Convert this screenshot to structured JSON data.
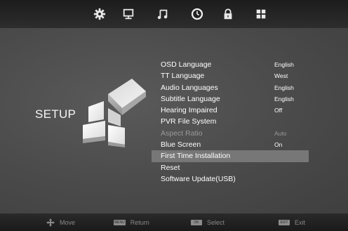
{
  "topbar": {
    "icons": [
      "gear-icon",
      "monitor-icon",
      "music-note-icon",
      "clock-icon",
      "lock-icon",
      "grid-icon"
    ]
  },
  "page_title": "SETUP",
  "menu": {
    "items": [
      {
        "label": "OSD Language",
        "value": "English",
        "state": "normal"
      },
      {
        "label": "TT Language",
        "value": "West",
        "state": "normal"
      },
      {
        "label": "Audio Languages",
        "value": "English",
        "state": "normal"
      },
      {
        "label": "Subtitle Language",
        "value": "English",
        "state": "normal"
      },
      {
        "label": "Hearing Impaired",
        "value": "Off",
        "state": "normal"
      },
      {
        "label": "PVR File System",
        "value": "",
        "state": "normal"
      },
      {
        "label": "Aspect Ratio",
        "value": "Auto",
        "state": "disabled"
      },
      {
        "label": "Blue Screen",
        "value": "On",
        "state": "normal"
      },
      {
        "label": "First Time Installation",
        "value": "",
        "state": "selected"
      },
      {
        "label": "Reset",
        "value": "",
        "state": "normal"
      },
      {
        "label": "Software Update(USB)",
        "value": "",
        "state": "normal"
      }
    ]
  },
  "bottombar": {
    "move_label": "Move",
    "return_key": "MENU",
    "return_label": "Return",
    "select_key": "OK",
    "select_label": "Select",
    "exit_key": "EXIT",
    "exit_label": "Exit"
  },
  "colors": {
    "background": "#4c4c4c",
    "topbar": "#1c1c1c",
    "selected_row": "#777777",
    "disabled_text": "#9a9a9a"
  }
}
